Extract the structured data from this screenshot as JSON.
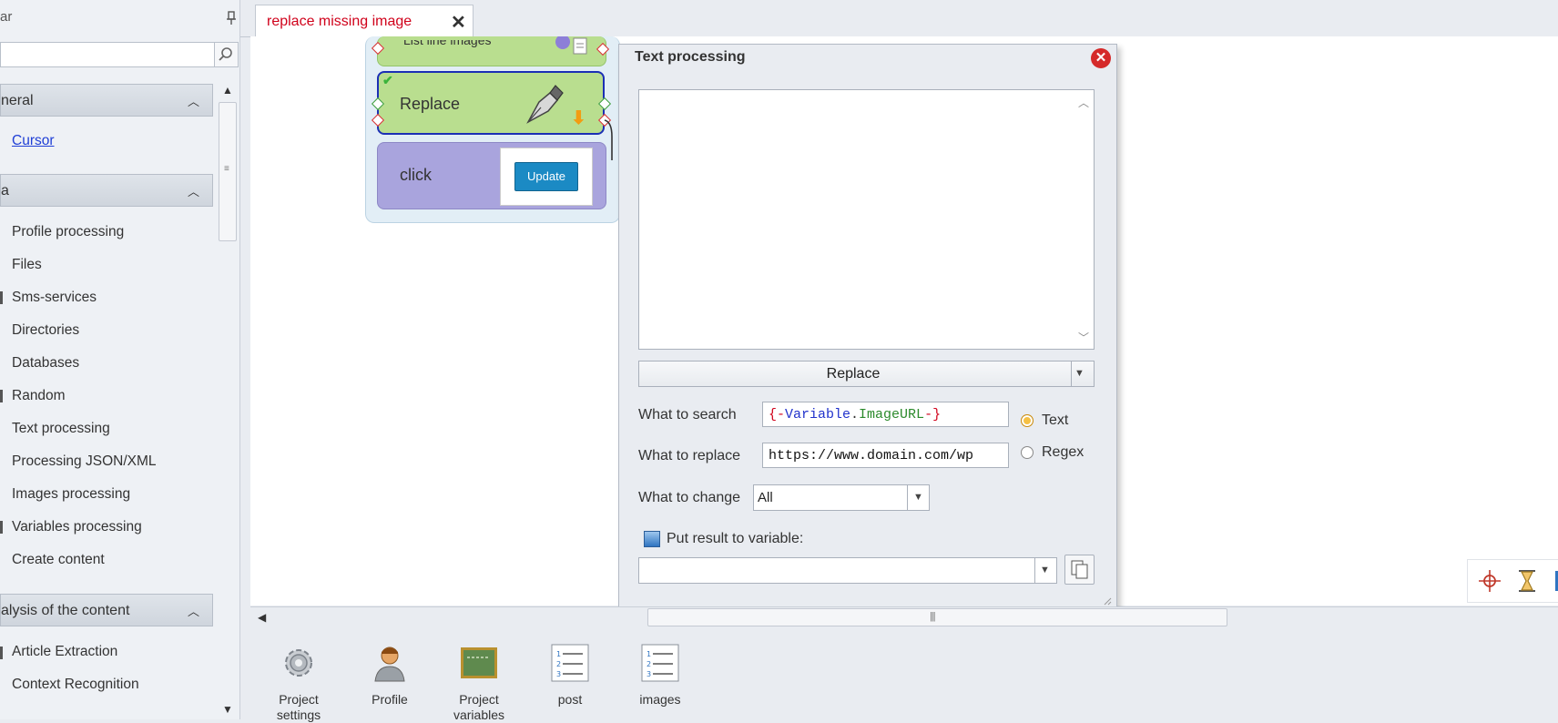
{
  "sidebar": {
    "title": "ar",
    "sections": [
      {
        "label": "neral",
        "items": [
          "Cursor"
        ]
      },
      {
        "label": "a",
        "items": [
          "Profile processing",
          "Files",
          "Sms-services",
          "Directories",
          "Databases",
          "Random",
          "Text processing",
          "Processing JSON/XML",
          "Images processing",
          "Variables processing",
          "Create content"
        ]
      },
      {
        "label": "alysis of the content",
        "items": [
          "Article Extraction",
          "Context Recognition"
        ]
      }
    ]
  },
  "tab": {
    "label": "replace missing image",
    "close_glyph": "✕"
  },
  "canvas": {
    "top_block_label": "List line images",
    "replace_block_label": "Replace",
    "click_block_label": "click",
    "update_button_label": "Update"
  },
  "dialog": {
    "title": "Text processing",
    "textarea_value": "",
    "mode": "Replace",
    "search_label": "What to search",
    "search_value": [
      "{-",
      "Variable",
      ".",
      "ImageURL",
      "-}"
    ],
    "replace_label": "What to replace",
    "replace_value": "https://www.domain.com/wp",
    "radio_text": "Text",
    "radio_regex": "Regex",
    "change_label": "What to change",
    "change_value": "All",
    "put_result_label": "Put result to variable:",
    "result_variable": ""
  },
  "bottom_toolbar": [
    {
      "label": "Project settings",
      "icon": "gear-icon"
    },
    {
      "label": "Profile",
      "icon": "user-icon"
    },
    {
      "label": "Project variables",
      "icon": "blackboard-icon"
    },
    {
      "label": "post",
      "icon": "numbered-list-icon"
    },
    {
      "label": "images",
      "icon": "numbered-list-icon"
    }
  ],
  "colors": {
    "tab_label": "#d0021b",
    "replace_block": "#b9de8f",
    "click_block": "#a9a4dd",
    "selected_border": "#1b2fb5",
    "update_button": "#1b8ac4"
  }
}
